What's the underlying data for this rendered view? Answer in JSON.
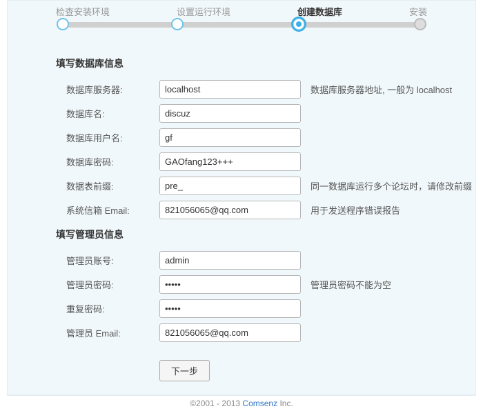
{
  "steps": {
    "s1": "检查安装环境",
    "s2": "设置运行环境",
    "s3": "创建数据库",
    "s4": "安装"
  },
  "db": {
    "title": "填写数据库信息",
    "server_label": "数据库服务器:",
    "server_value": "localhost",
    "server_hint": "数据库服务器地址, 一般为 localhost",
    "name_label": "数据库名:",
    "name_value": "discuz",
    "user_label": "数据库用户名:",
    "user_value": "gf",
    "pass_label": "数据库密码:",
    "pass_value": "GAOfang123+++",
    "prefix_label": "数据表前缀:",
    "prefix_value": "pre_",
    "prefix_hint": "同一数据库运行多个论坛时，请修改前缀",
    "email_label": "系统信箱 Email:",
    "email_value": "821056065@qq.com",
    "email_hint": "用于发送程序错误报告"
  },
  "admin": {
    "title": "填写管理员信息",
    "user_label": "管理员账号:",
    "user_value": "admin",
    "pass_label": "管理员密码:",
    "pass_value": "•••••",
    "pass_hint": "管理员密码不能为空",
    "repass_label": "重复密码:",
    "repass_value": "•••••",
    "email_label": "管理员 Email:",
    "email_value": "821056065@qq.com"
  },
  "actions": {
    "next": "下一步"
  },
  "footer": {
    "copyright": "©2001 - 2013 ",
    "link": "Comsenz",
    "suffix": " Inc."
  }
}
